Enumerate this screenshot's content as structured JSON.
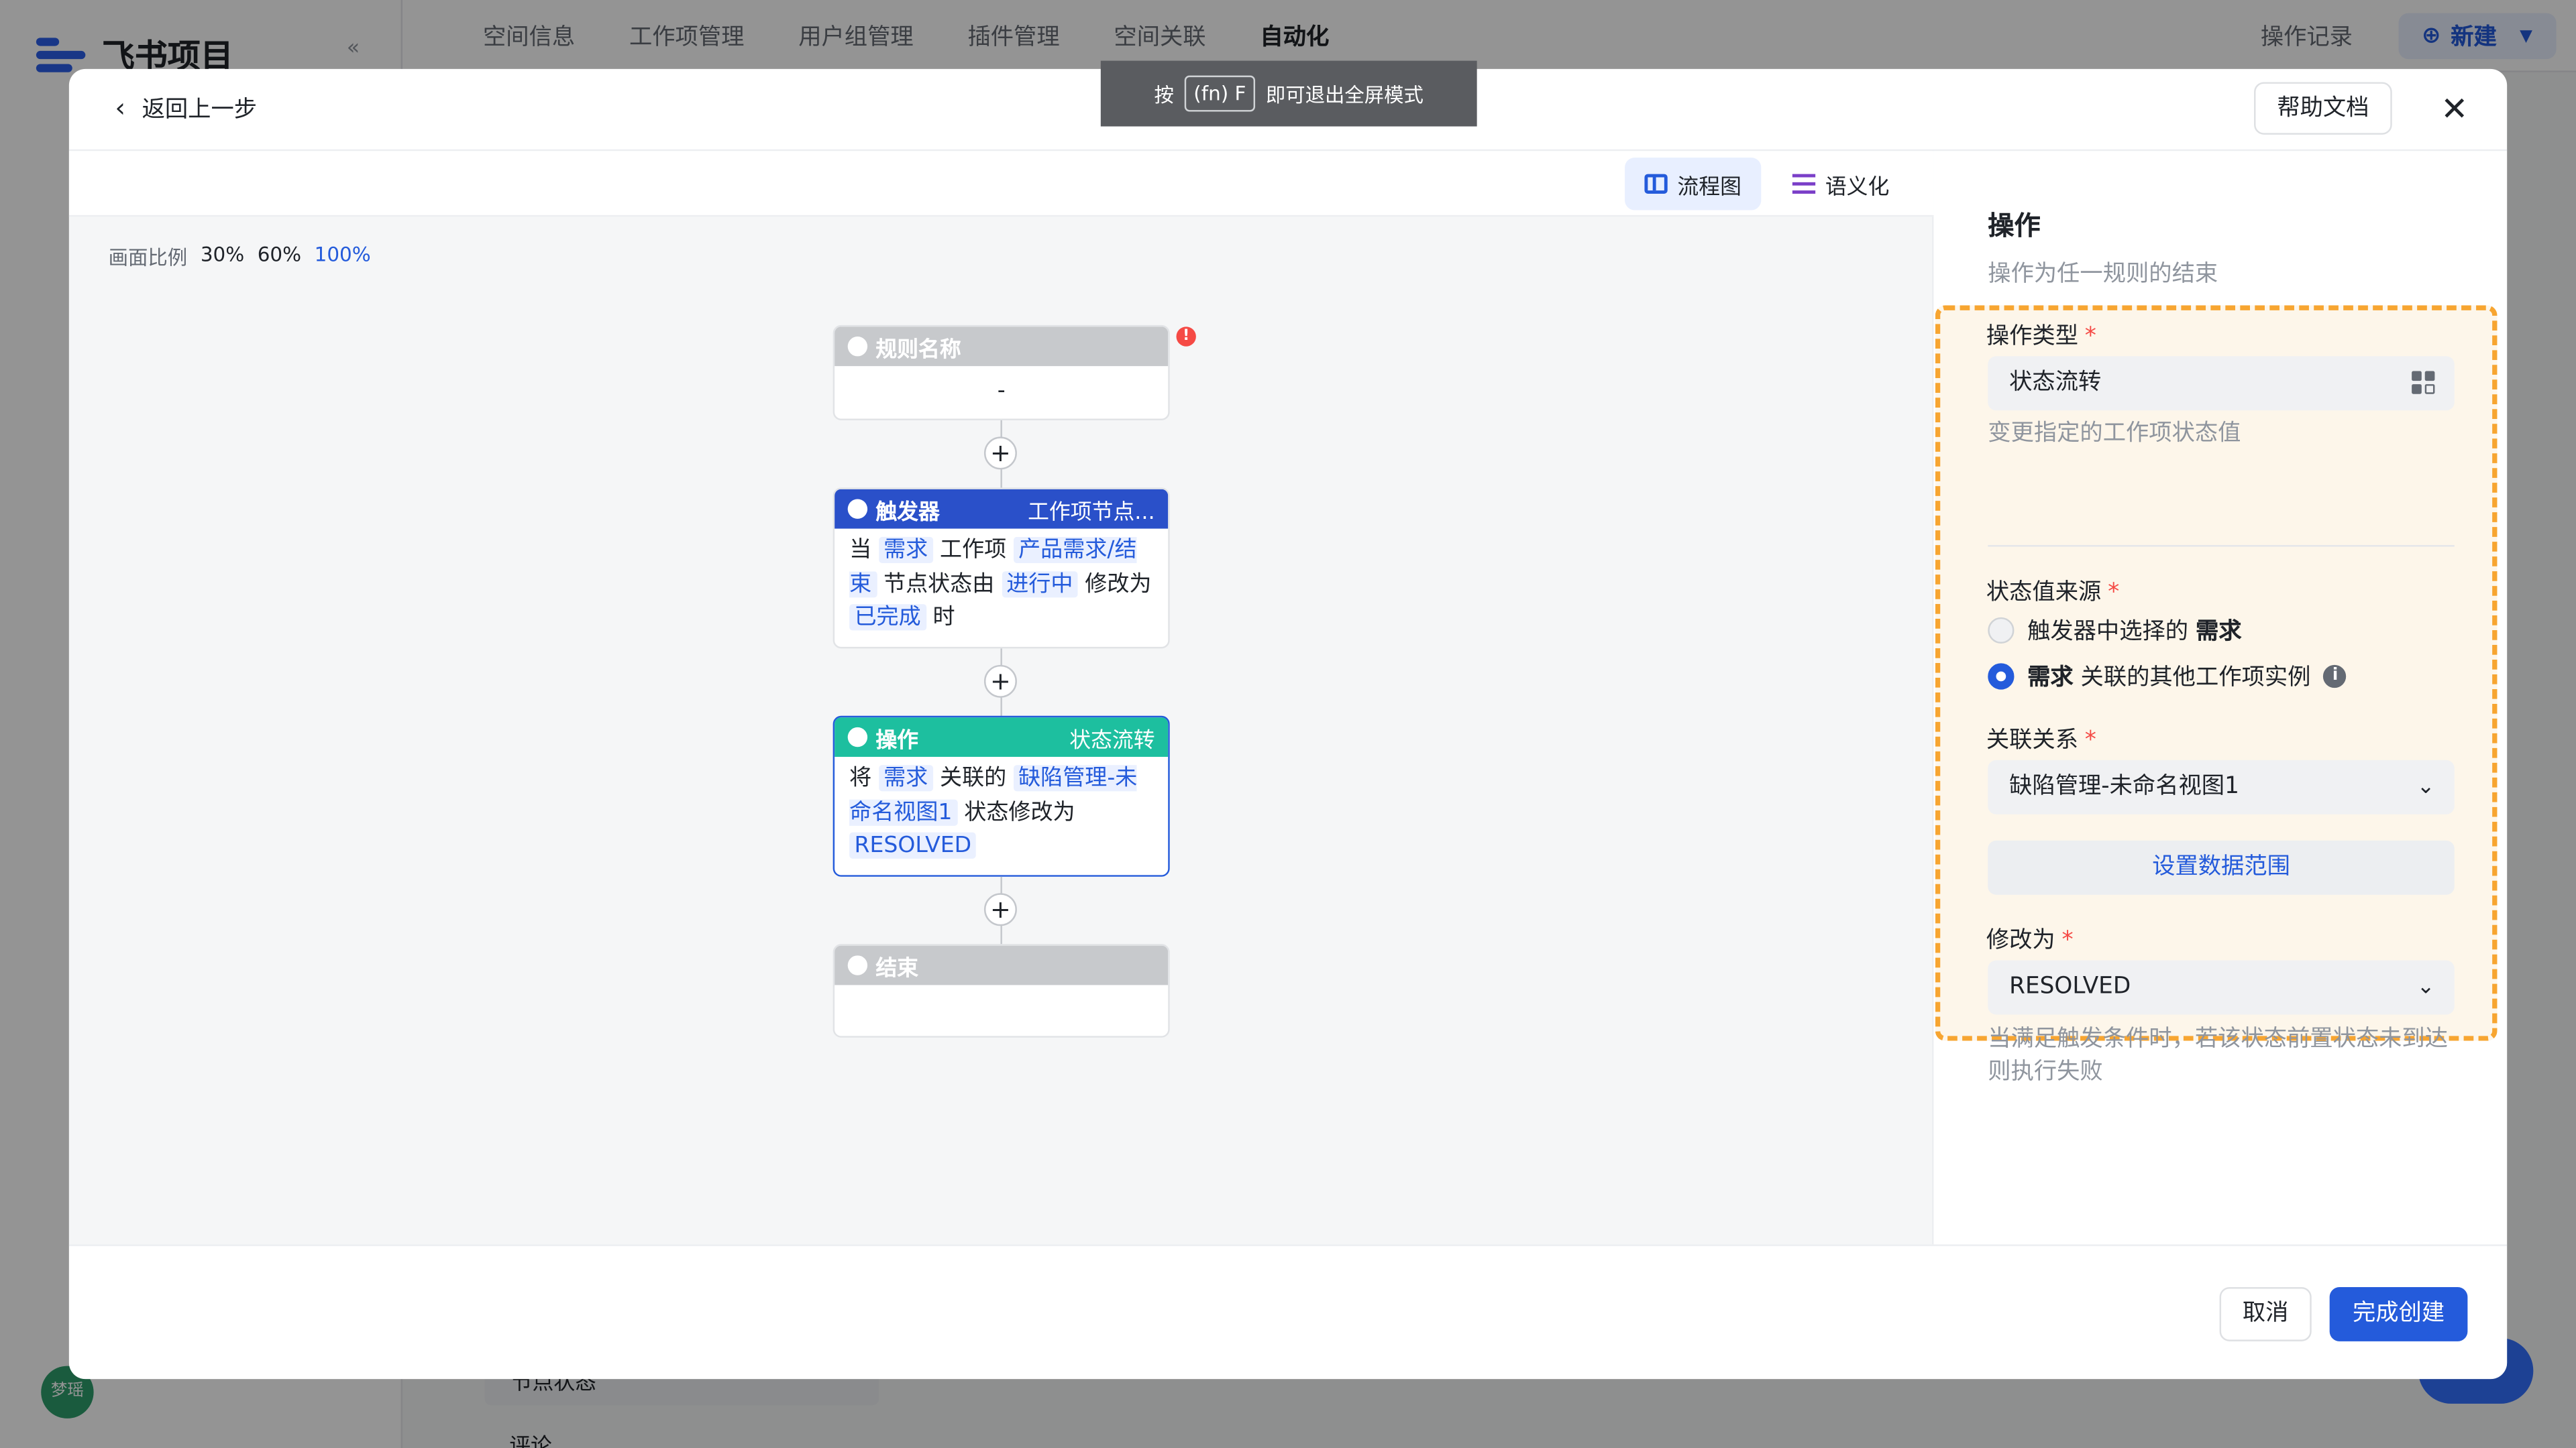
{
  "background": {
    "app_name": "飞书项目",
    "tabs": [
      "空间信息",
      "工作项管理",
      "用户组管理",
      "插件管理",
      "空间关联",
      "自动化"
    ],
    "active_tab": "自动化",
    "log_button": "操作记录",
    "new_button": "新建",
    "avatar_text": "梦瑶",
    "bottom_item": "节点状态",
    "bottom_item2": "评论"
  },
  "toast": {
    "prefix": "按",
    "key": "(fn) F",
    "suffix": "即可退出全屏模式"
  },
  "header": {
    "back_label": "返回上一步",
    "help_label": "帮助文档",
    "close_glyph": "✕"
  },
  "view": {
    "flow_label": "流程图",
    "semantic_label": "语义化"
  },
  "zoom": {
    "label": "画面比例",
    "options": [
      "30%",
      "60%",
      "100%"
    ],
    "active": "100%"
  },
  "flow": {
    "rule": {
      "title": "规则名称",
      "value": "-"
    },
    "trigger": {
      "title": "触发器",
      "tag": "工作项节点...",
      "t1": "当",
      "h1": "需求",
      "t2": "工作项",
      "h2": "产品需求/结束",
      "t3": "节点状态由",
      "h3": "进行中",
      "t4": "修改为",
      "h4": "已完成",
      "t5": "时"
    },
    "action": {
      "title": "操作",
      "tag": "状态流转",
      "t1": "将",
      "h1": "需求",
      "t2": "关联的",
      "h2": "缺陷管理-未命名视图1",
      "t3": "状态修改为",
      "h3": "RESOLVED"
    },
    "end": {
      "title": "结束"
    },
    "plus": "+",
    "error_glyph": "!"
  },
  "panel": {
    "title": "操作",
    "desc": "操作为任一规则的结束",
    "op_type_label": "操作类型",
    "op_type_value": "状态流转",
    "op_type_hint": "变更指定的工作项状态值",
    "source_label": "状态值来源",
    "source_opt1_text": "触发器中选择的",
    "source_opt1_bold": "需求",
    "source_opt2_bold": "需求",
    "source_opt2_text": "关联的其他工作项实例",
    "relation_label": "关联关系",
    "relation_value": "缺陷管理-未命名视图1",
    "range_button": "设置数据范围",
    "modify_label": "修改为",
    "modify_value": "RESOLVED",
    "modify_hint": "当满足触发条件时，若该状态前置状态未到达则执行失败",
    "required_mark": "*"
  },
  "footer": {
    "cancel_label": "取消",
    "create_label": "完成创建"
  },
  "colors": {
    "accent": "#245bdb",
    "trigger": "#2a50c9",
    "action": "#1dbf9f",
    "highlight_border": "#f7a531"
  }
}
